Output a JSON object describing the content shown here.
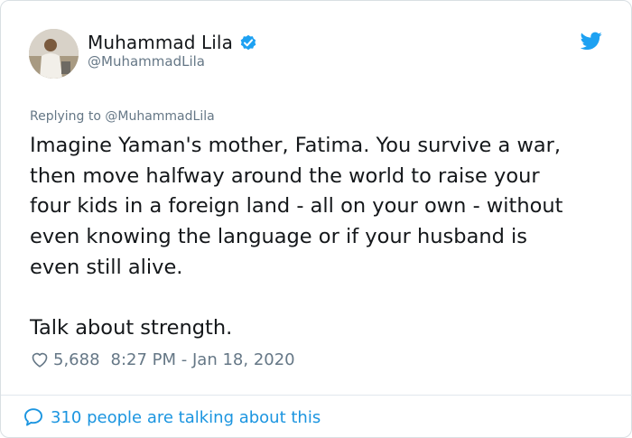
{
  "author": {
    "display_name": "Muhammad Lila",
    "handle": "@MuhammadLila",
    "verified": true
  },
  "tweet": {
    "replying_to": "Replying to @MuhammadLila",
    "text": "Imagine Yaman's mother, Fatima.  You survive a war,\nthen move halfway around the world to raise your\nfour kids in a foreign land - all on your own - without\neven knowing the language or if your husband is\neven still alive.\n\nTalk about strength.",
    "likes": "5,688",
    "timestamp": "8:27 PM - Jan 18, 2020"
  },
  "footer": {
    "conversation_text": "310 people are talking about this"
  },
  "icons": {
    "verified": "verified-badge-icon",
    "bird": "twitter-bird-icon",
    "heart": "heart-icon",
    "bubble": "speech-bubble-icon"
  },
  "colors": {
    "accent": "#1da1f2",
    "link": "#1b95e0",
    "secondary_text": "#657786",
    "primary_text": "#14171a",
    "border": "#e1e8ed"
  }
}
